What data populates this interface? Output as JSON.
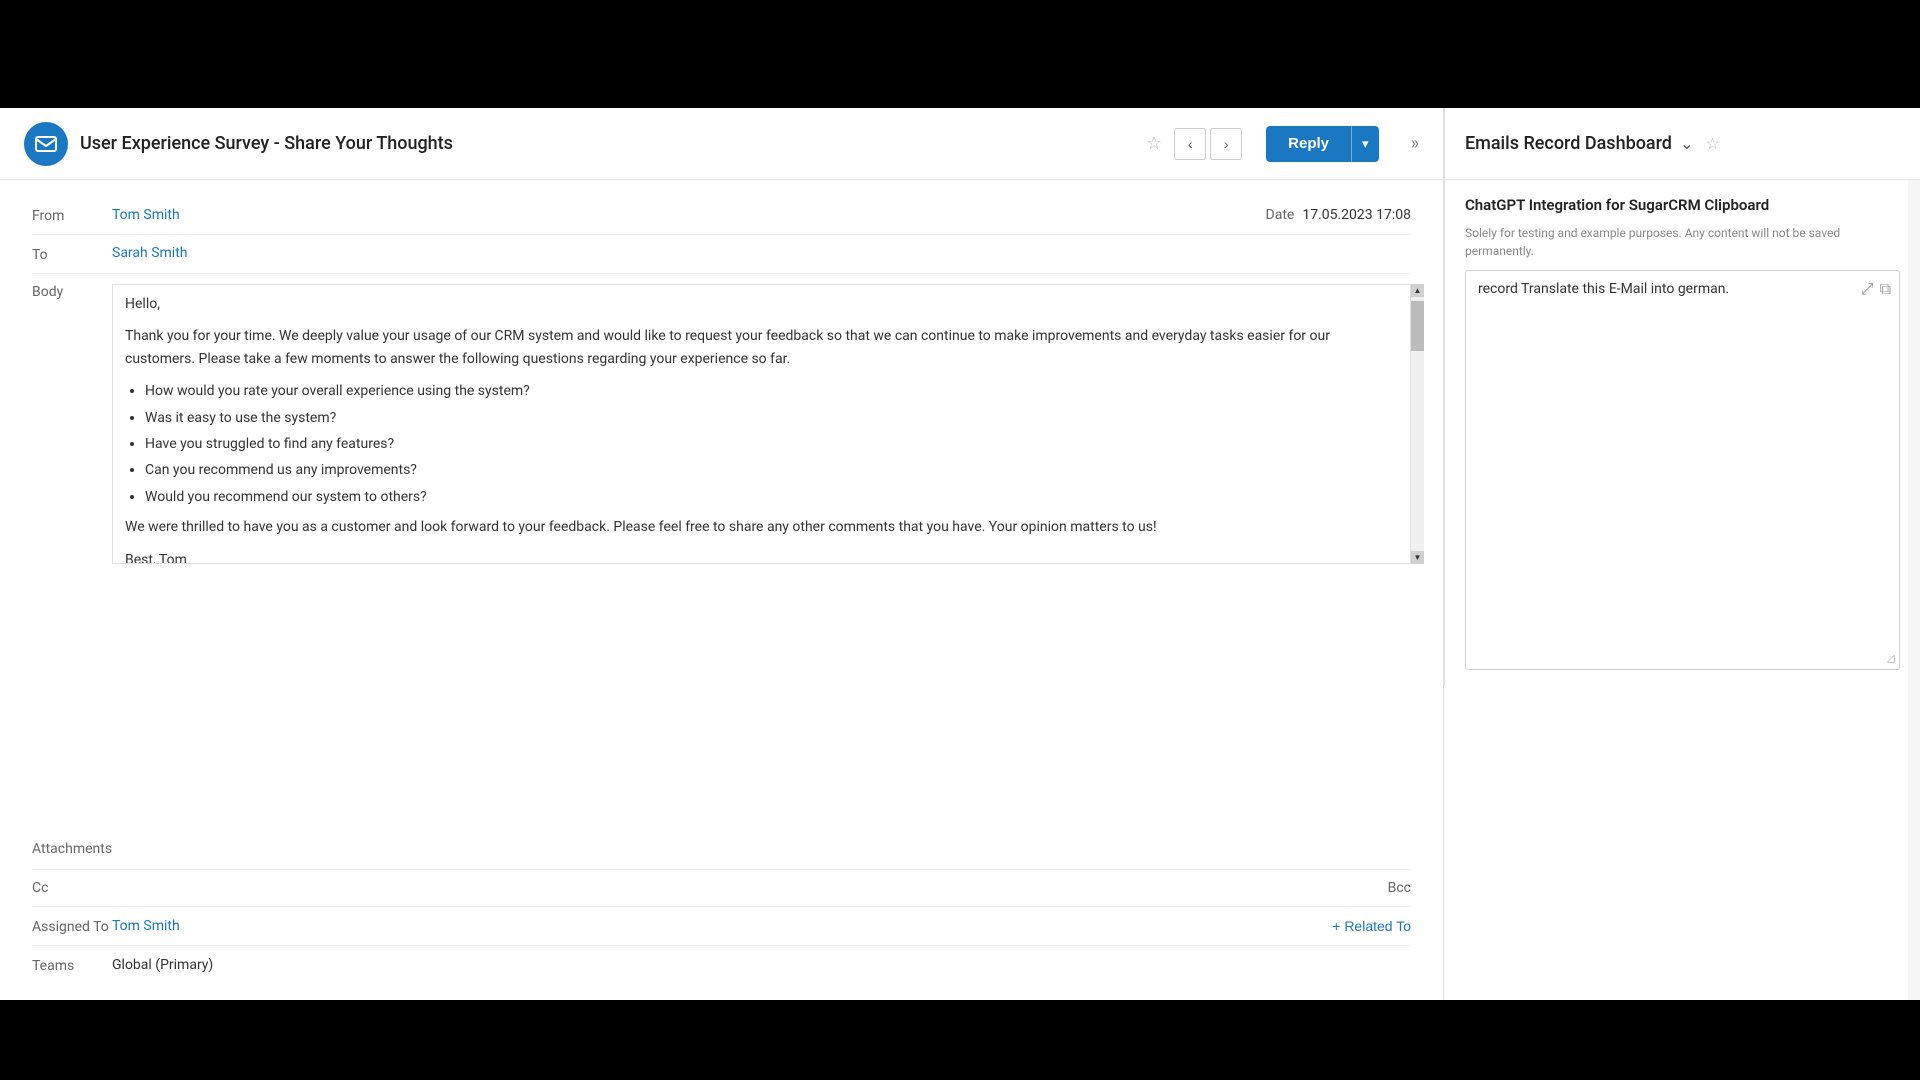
{
  "header": {
    "title": "User Experience Survey - Share Your Thoughts",
    "star_icon": "☆",
    "reply_label": "Reply",
    "dropdown_icon": "▾",
    "double_arrow": "»"
  },
  "email": {
    "from_label": "From",
    "from_value": "Tom Smith",
    "to_label": "To",
    "to_value": "Sarah Smith",
    "date_label": "Date",
    "date_value": "17.05.2023 17:08",
    "body_label": "Body",
    "body_greeting": "Hello,",
    "body_para1": "Thank you for your time. We deeply value your usage of our CRM system and would like to request your feedback so that we can continue to make improvements and everyday tasks easier for our customers. Please take a few moments to answer the following questions regarding your experience so far.",
    "body_questions": [
      "How would you rate your overall experience using the system?",
      "Was it easy to use the system?",
      "Have you struggled to find any features?",
      "Can you recommend us any improvements?",
      "Would you recommend our system to others?"
    ],
    "body_closing": "We were thrilled to have you as a customer and look forward to your feedback. Please feel free to share any other comments that you have. Your opinion matters to us!",
    "body_sign": "Best, Tom",
    "attachments_label": "Attachments",
    "cc_label": "Cc",
    "bcc_label": "Bcc",
    "assigned_to_label": "Assigned To",
    "assigned_to_value": "Tom Smith",
    "related_to_label": "+ Related To",
    "teams_label": "Teams",
    "teams_value": "Global (Primary)"
  },
  "right_panel": {
    "title": "Emails Record Dashboard",
    "chevron": "⌄",
    "star": "☆",
    "chatgpt_title": "ChatGPT Integration for SugarCRM Clipboard",
    "chatgpt_subtitle": "Solely for testing and example purposes. Any content will not be saved permanently.",
    "textarea_value": "record Translate this E-Mail into german.",
    "expand_icon": "⤢",
    "copy_icon": "⧉"
  },
  "colors": {
    "accent": "#1a78c2",
    "border": "#e0e0e0",
    "bg": "#fff",
    "text_muted": "#888"
  }
}
